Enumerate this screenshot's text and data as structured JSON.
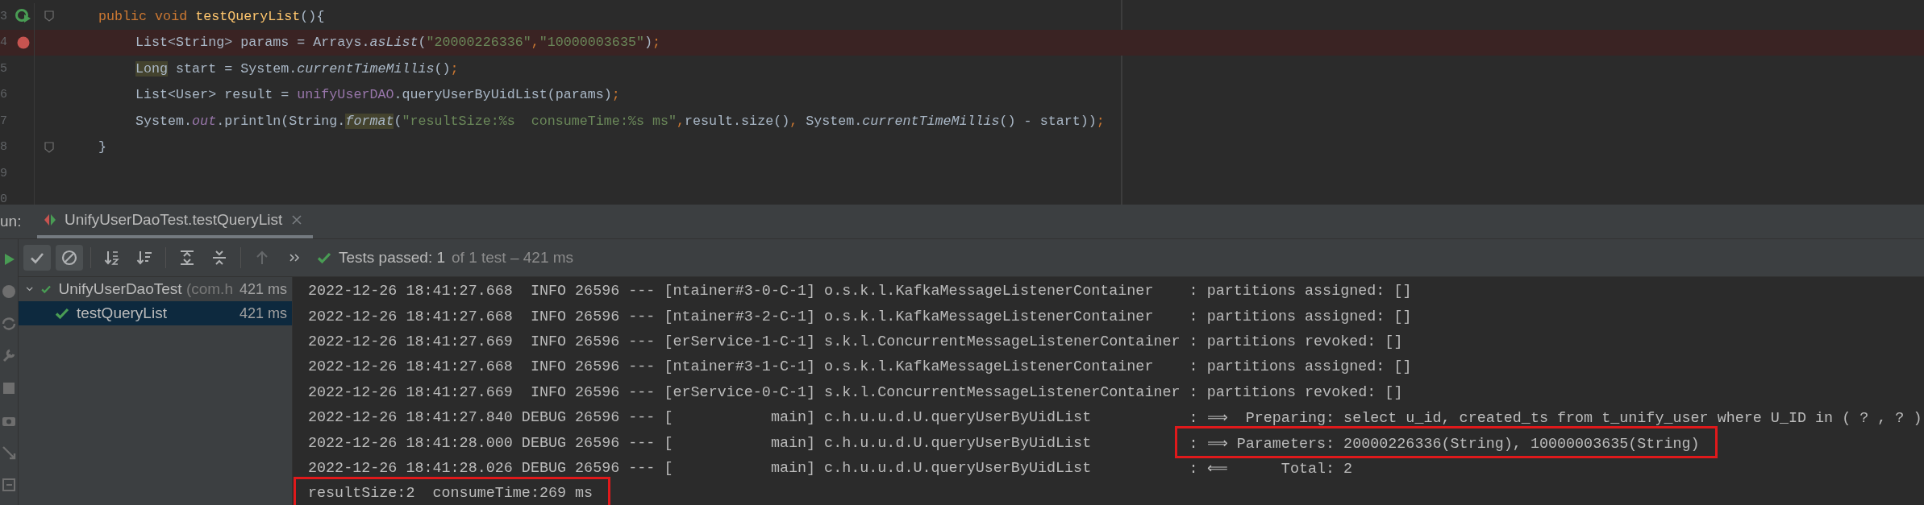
{
  "editor": {
    "lines": [
      {
        "number": "3",
        "runnable": true,
        "fold": true,
        "breakpoint": false,
        "tokens": [
          {
            "kind": "keyword",
            "text": "public void "
          },
          {
            "kind": "declaration",
            "text": "testQueryList"
          },
          {
            "kind": "plain",
            "text": "(){"
          }
        ],
        "children": [
          {
            "number": "4",
            "runnable": false,
            "fold": false,
            "breakpoint": true,
            "tokens": [
              {
                "kind": "plain",
                "text": "List<String> params = Arrays."
              },
              {
                "kind": "static",
                "text": "asList"
              },
              {
                "kind": "plain",
                "text": "("
              },
              {
                "kind": "string",
                "text": "\"20000226336\""
              },
              {
                "kind": "keyword",
                "text": ","
              },
              {
                "kind": "string",
                "text": "\"10000003635\""
              },
              {
                "kind": "plain",
                "text": ")"
              },
              {
                "kind": "keyword",
                "text": ";"
              }
            ]
          },
          {
            "number": "5",
            "runnable": false,
            "fold": false,
            "breakpoint": false,
            "tokens": [
              {
                "kind": "marked",
                "text": "Long"
              },
              {
                "kind": "plain",
                "text": " start = System."
              },
              {
                "kind": "static",
                "text": "currentTimeMillis"
              },
              {
                "kind": "plain",
                "text": "()"
              },
              {
                "kind": "keyword",
                "text": ";"
              }
            ]
          },
          {
            "number": "6",
            "runnable": false,
            "fold": false,
            "breakpoint": false,
            "tokens": [
              {
                "kind": "plain",
                "text": "List<User> result = "
              },
              {
                "kind": "field",
                "text": "unifyUserDAO"
              },
              {
                "kind": "plain",
                "text": ".queryUserByUidList(params)"
              },
              {
                "kind": "keyword",
                "text": ";"
              }
            ]
          },
          {
            "number": "7",
            "runnable": false,
            "fold": false,
            "breakpoint": false,
            "tokens": [
              {
                "kind": "plain",
                "text": "System."
              },
              {
                "kind": "static-field",
                "text": "out"
              },
              {
                "kind": "plain",
                "text": ".println(String."
              },
              {
                "kind": "marked-static",
                "text": "format"
              },
              {
                "kind": "plain",
                "text": "("
              },
              {
                "kind": "string",
                "text": "\"resultSize:%s  consumeTime:%s ms\""
              },
              {
                "kind": "keyword",
                "text": ","
              },
              {
                "kind": "plain",
                "text": "result.size()"
              },
              {
                "kind": "keyword",
                "text": ","
              },
              {
                "kind": "plain",
                "text": " System."
              },
              {
                "kind": "static",
                "text": "currentTimeMillis"
              },
              {
                "kind": "plain",
                "text": "() - start))"
              },
              {
                "kind": "keyword",
                "text": ";"
              }
            ]
          }
        ]
      },
      {
        "number": "8",
        "runnable": false,
        "fold": true,
        "breakpoint": false,
        "tokens": [
          {
            "kind": "plain",
            "text": "}"
          }
        ]
      },
      {
        "number": "9",
        "runnable": false,
        "fold": false,
        "breakpoint": false
      },
      {
        "number": "0",
        "runnable": false,
        "fold": false,
        "breakpoint": false
      }
    ]
  },
  "run_panel": {
    "label": "un:",
    "tab": {
      "label": "UnifyUserDaoTest.testQueryList",
      "selected": true
    },
    "toolbar": {
      "buttons": [
        {
          "kind": "show-passed",
          "selected": true
        },
        {
          "kind": "show-ignored",
          "selected": true
        },
        {
          "kind": "sort-alpha",
          "selected": false
        },
        {
          "kind": "sort-duration",
          "selected": false
        },
        {
          "kind": "expand-all"
        },
        {
          "kind": "collapse-all"
        },
        {
          "kind": "previous",
          "disabled": true
        },
        {
          "kind": "more"
        }
      ]
    },
    "status": {
      "passed": true,
      "summary": "Tests passed: 1",
      "detail": "of 1 test – 421 ms"
    },
    "tree": [
      {
        "label": "UnifyUserDaoTest",
        "package": "(com.h",
        "duration": "421 ms",
        "passed": true,
        "selected": false,
        "expanded": true,
        "children": [
          {
            "label": "testQueryList",
            "duration": "421 ms",
            "passed": true,
            "selected": true
          }
        ]
      }
    ],
    "console": [
      {
        "head": "2022-12-26 18:41:27.668  INFO 26596 --- [ntainer#3-0-C-1] o.s.k.l.KafkaMessageListenerContainer",
        "message": ": partitions assigned: []",
        "highlighted": false
      },
      {
        "head": "2022-12-26 18:41:27.668  INFO 26596 --- [ntainer#3-2-C-1] o.s.k.l.KafkaMessageListenerContainer",
        "message": ": partitions assigned: []",
        "highlighted": false
      },
      {
        "head": "2022-12-26 18:41:27.669  INFO 26596 --- [erService-1-C-1] s.k.l.ConcurrentMessageListenerContainer",
        "message": ": partitions revoked: []",
        "highlighted": false
      },
      {
        "head": "2022-12-26 18:41:27.668  INFO 26596 --- [ntainer#3-1-C-1] o.s.k.l.KafkaMessageListenerContainer",
        "message": ": partitions assigned: []",
        "highlighted": false
      },
      {
        "head": "2022-12-26 18:41:27.669  INFO 26596 --- [erService-0-C-1] s.k.l.ConcurrentMessageListenerContainer",
        "message": ": partitions revoked: []",
        "highlighted": false
      },
      {
        "head": "2022-12-26 18:41:27.840 DEBUG 26596 --- [           main] c.h.u.u.d.U.queryUserByUidList",
        "message": ": ⟹  Preparing: select u_id, created_ts from t_unify_user where U_ID in ( ? , ? )",
        "highlighted": false
      },
      {
        "head": "2022-12-26 18:41:28.000 DEBUG 26596 --- [           main] c.h.u.u.d.U.queryUserByUidList",
        "message": ": ⟹ Parameters: 20000226336(String), 10000003635(String)",
        "highlighted": true
      },
      {
        "head": "2022-12-26 18:41:28.026 DEBUG 26596 --- [           main] c.h.u.u.d.U.queryUserByUidList",
        "message": ": ⟸      Total: 2",
        "highlighted": false
      },
      {
        "message": "resultSize:2  consumeTime:269 ms",
        "highlighted": true
      }
    ]
  }
}
